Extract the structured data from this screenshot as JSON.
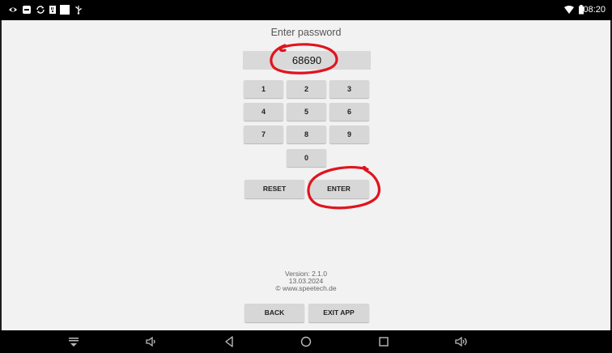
{
  "status_bar": {
    "time": "08:20",
    "left_icons": [
      "eye-icon",
      "screen-mirror-icon",
      "sync-icon",
      "sd-card-icon",
      "blank-square-icon",
      "usb-icon"
    ],
    "right_icons": [
      "wifi-icon",
      "battery-icon"
    ]
  },
  "login": {
    "title": "Enter password",
    "password_value": "68690"
  },
  "keypad": {
    "keys": [
      "1",
      "2",
      "3",
      "4",
      "5",
      "6",
      "7",
      "8",
      "9",
      "0"
    ],
    "reset_label": "RESET",
    "enter_label": "ENTER"
  },
  "info": {
    "version": "Version: 2.1.0",
    "date": "13.03.2024",
    "copyright": "© www.speetech.de"
  },
  "bottom_buttons": {
    "back_label": "BACK",
    "exit_label": "EXIT APP"
  },
  "annotations": {
    "color": "#e0141e"
  },
  "nav_bar": {
    "icons": [
      "keyboard-hide-icon",
      "volume-down-icon",
      "back-icon",
      "home-icon",
      "recents-icon",
      "volume-up-icon"
    ]
  }
}
